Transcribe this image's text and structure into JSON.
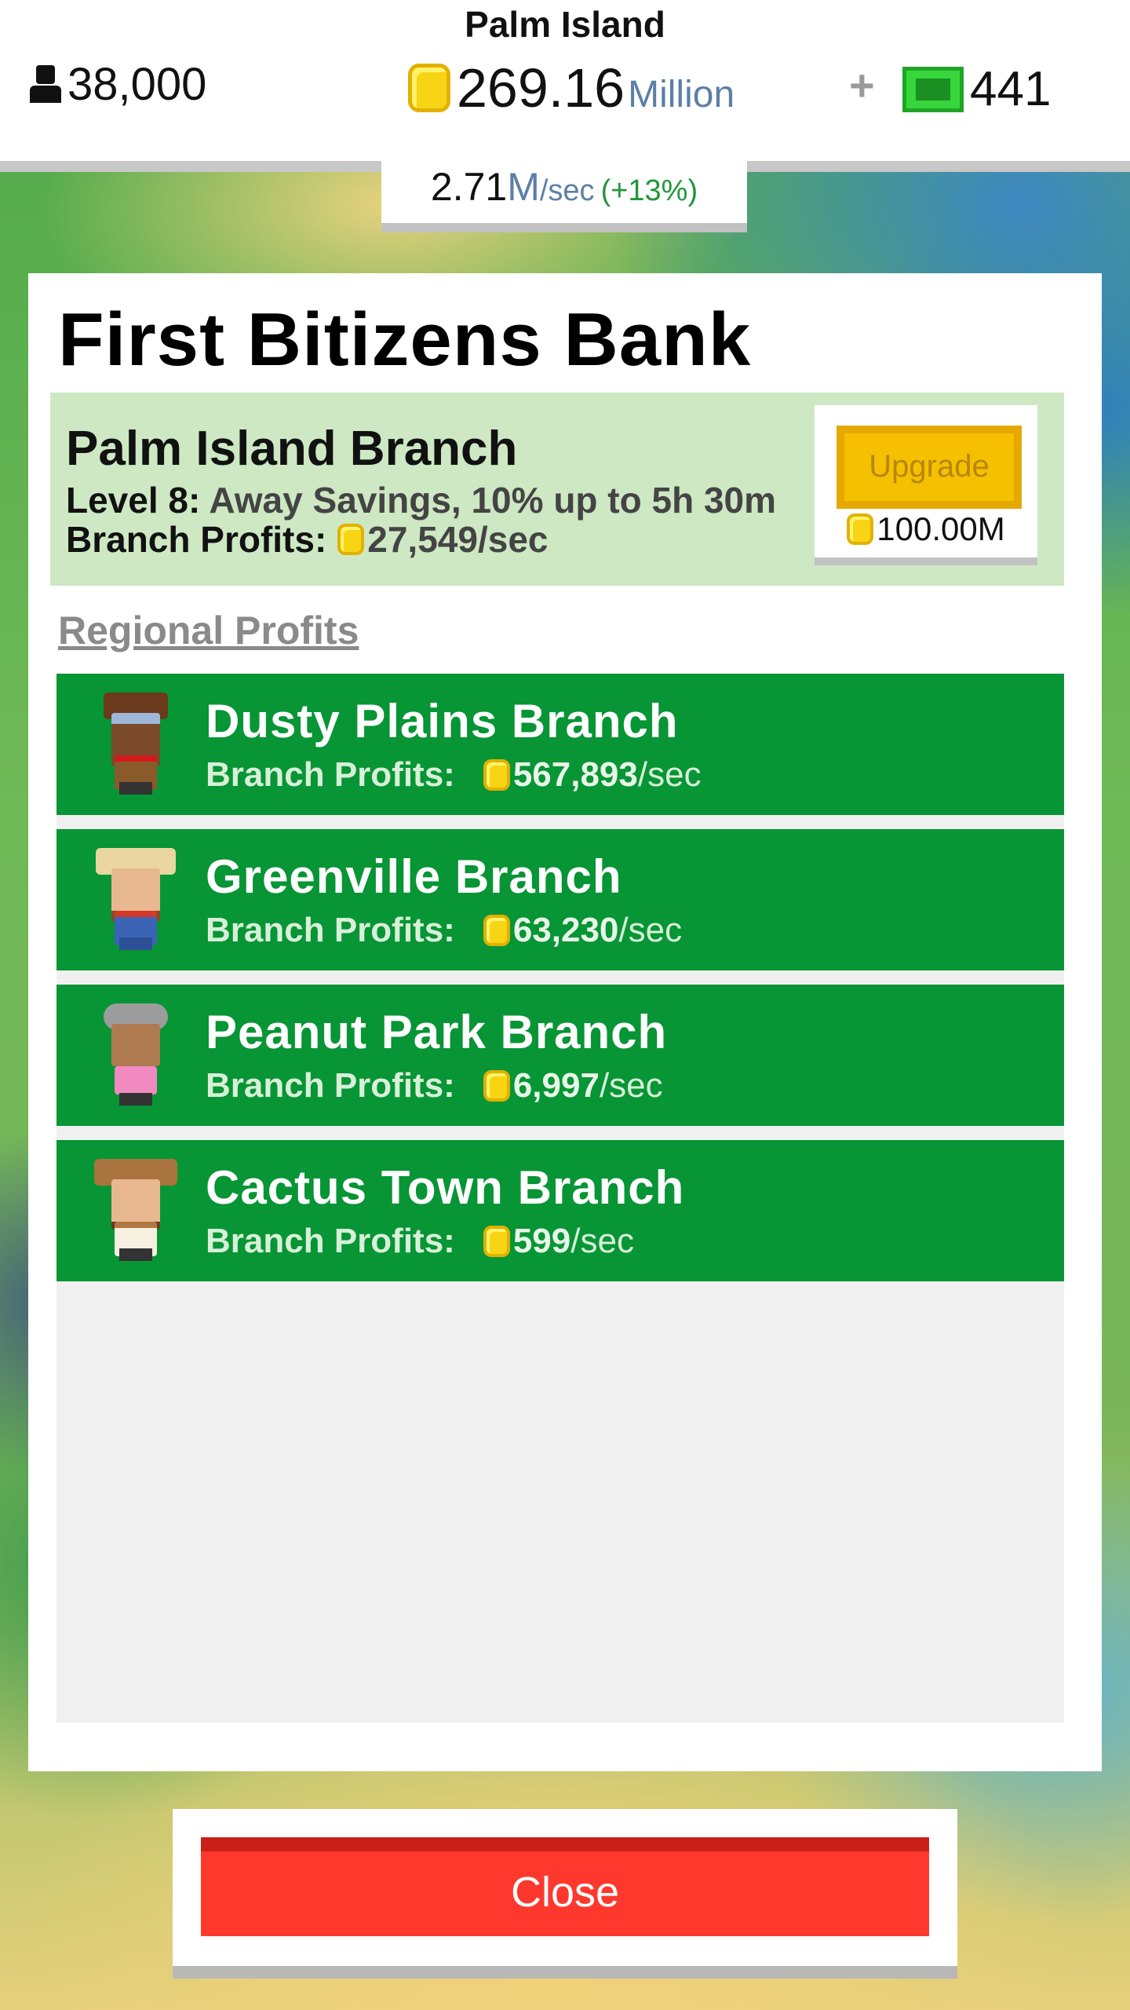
{
  "hud": {
    "island_name": "Palm Island",
    "population": "38,000",
    "money_value": "269.16",
    "money_unit": "Million",
    "plus": "+",
    "cash": "441",
    "rate_value": "2.71",
    "rate_unit": "M",
    "rate_sec": "/sec",
    "rate_bonus": "(+13%)"
  },
  "bank": {
    "title": "First Bitizens Bank",
    "home_branch": {
      "name": "Palm Island Branch",
      "level_label": "Level 8:",
      "level_desc": "Away Savings, 10% up to 5h 30m",
      "profit_label": "Branch Profits:",
      "profit_amount": "27,549/sec"
    },
    "upgrade": {
      "label": "Upgrade",
      "cost": "100.00M"
    },
    "regional_title": "Regional Profits",
    "branches": [
      {
        "name": "Dusty Plains Branch",
        "profit_label": "Branch Profits:",
        "amount": "567,893",
        "sec": "/sec"
      },
      {
        "name": "Greenville Branch",
        "profit_label": "Branch Profits:",
        "amount": "63,230",
        "sec": "/sec"
      },
      {
        "name": "Peanut Park Branch",
        "profit_label": "Branch Profits:",
        "amount": "6,997",
        "sec": "/sec"
      },
      {
        "name": "Cactus Town Branch",
        "profit_label": "Branch Profits:",
        "amount": "599",
        "sec": "/sec"
      }
    ]
  },
  "close_label": "Close",
  "colors": {
    "branch_green": "#079535",
    "home_bg": "#cde8c3",
    "upgrade_gold": "#f5c000",
    "close_red": "#fe382d",
    "unit_blue": "#5c7fa5"
  },
  "icons": {
    "population": "person-icon",
    "coin": "coin-icon",
    "cash": "cash-icon",
    "avatars": [
      "pilot-avatar-icon",
      "farmer-avatar-icon",
      "grandma-avatar-icon",
      "cowboy-avatar-icon"
    ]
  }
}
